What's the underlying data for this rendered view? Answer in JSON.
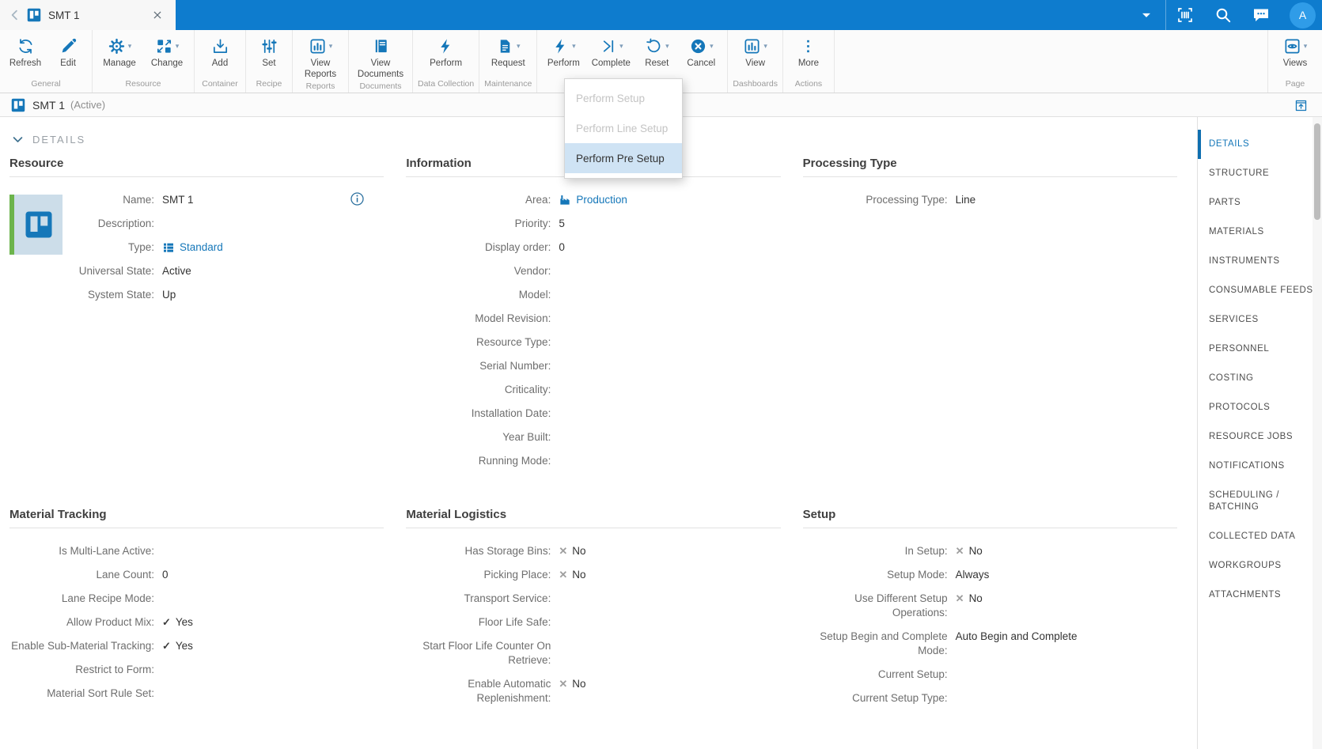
{
  "colors": {
    "topbar": "#0e7cce",
    "accent": "#1577b9",
    "menu_highlight": "#cfe3f4",
    "tile_green": "#6cb44c"
  },
  "topbar": {
    "tab": {
      "title": "SMT 1"
    },
    "avatar": {
      "initial": "A"
    },
    "icons": [
      "chevron-left-icon",
      "resource-board-icon",
      "close-icon",
      "dropdown-caret-icon",
      "barcode-scanner-icon",
      "search-icon",
      "messages-icon"
    ]
  },
  "toolbar": {
    "groups": [
      {
        "label": "General",
        "buttons": [
          {
            "label": "Refresh",
            "icon": "refresh-icon",
            "caret": false
          },
          {
            "label": "Edit",
            "icon": "edit-pencil-icon",
            "caret": false
          }
        ]
      },
      {
        "label": "Resource",
        "buttons": [
          {
            "label": "Manage",
            "icon": "manage-gear-icon",
            "caret": true
          },
          {
            "label": "Change",
            "icon": "change-swap-icon",
            "caret": true
          }
        ]
      },
      {
        "label": "Container",
        "buttons": [
          {
            "label": "Add",
            "icon": "add-tray-icon",
            "caret": false
          }
        ]
      },
      {
        "label": "Recipe",
        "buttons": [
          {
            "label": "Set",
            "icon": "sliders-icon",
            "caret": false
          }
        ]
      },
      {
        "label": "Reports",
        "buttons": [
          {
            "label": "View Reports",
            "icon": "bar-chart-icon",
            "caret": true
          }
        ]
      },
      {
        "label": "Documents",
        "buttons": [
          {
            "label": "View Documents",
            "icon": "documents-book-icon",
            "caret": false
          }
        ]
      },
      {
        "label": "Data Collection",
        "buttons": [
          {
            "label": "Perform",
            "icon": "lightning-icon",
            "caret": false
          }
        ]
      },
      {
        "label": "Maintenance",
        "buttons": [
          {
            "label": "Request",
            "icon": "document-page-icon",
            "caret": true
          }
        ]
      },
      {
        "label": "",
        "buttons": [
          {
            "label": "Perform",
            "icon": "lightning-icon",
            "caret": true
          },
          {
            "label": "Complete",
            "icon": "skip-end-icon",
            "caret": true
          },
          {
            "label": "Reset",
            "icon": "reset-arrow-icon",
            "caret": true
          },
          {
            "label": "Cancel",
            "icon": "cancel-circle-icon",
            "caret": true
          }
        ]
      },
      {
        "label": "Dashboards",
        "buttons": [
          {
            "label": "View",
            "icon": "bar-chart-icon",
            "caret": true
          }
        ]
      },
      {
        "label": "Actions",
        "buttons": [
          {
            "label": "More",
            "icon": "more-dots-icon",
            "caret": false
          }
        ]
      },
      {
        "label": "Page",
        "buttons": [
          {
            "label": "Views",
            "icon": "views-eye-icon",
            "caret": true
          }
        ]
      }
    ]
  },
  "perform_menu": {
    "items": [
      {
        "label": "Perform Setup",
        "disabled": true,
        "highlighted": false
      },
      {
        "label": "Perform Line Setup",
        "disabled": true,
        "highlighted": false
      },
      {
        "label": "Perform Pre Setup",
        "disabled": false,
        "highlighted": true
      }
    ]
  },
  "breadcrumb": {
    "title": "SMT 1",
    "state": "(Active)"
  },
  "details_section": {
    "label": "DETAILS"
  },
  "panels": {
    "resource": {
      "title": "Resource",
      "fields": [
        {
          "label": "Name:",
          "value": "SMT 1",
          "value_icon": null
        },
        {
          "label": "Description:",
          "value": "",
          "value_icon": null
        },
        {
          "label": "Type:",
          "value": "Standard",
          "value_icon": "list-icon",
          "link": true
        },
        {
          "label": "Universal State:",
          "value": "Active",
          "value_icon": null
        },
        {
          "label": "System State:",
          "value": "Up",
          "value_icon": null
        }
      ]
    },
    "information": {
      "title": "Information",
      "fields": [
        {
          "label": "Area:",
          "value": "Production",
          "value_icon": "factory-icon",
          "link": true
        },
        {
          "label": "Priority:",
          "value": "5",
          "value_icon": null
        },
        {
          "label": "Display order:",
          "value": "0",
          "value_icon": null
        },
        {
          "label": "Vendor:",
          "value": "",
          "value_icon": null
        },
        {
          "label": "Model:",
          "value": "",
          "value_icon": null
        },
        {
          "label": "Model Revision:",
          "value": "",
          "value_icon": null
        },
        {
          "label": "Resource Type:",
          "value": "",
          "value_icon": null
        },
        {
          "label": "Serial Number:",
          "value": "",
          "value_icon": null
        },
        {
          "label": "Criticality:",
          "value": "",
          "value_icon": null
        },
        {
          "label": "Installation Date:",
          "value": "",
          "value_icon": null
        },
        {
          "label": "Year Built:",
          "value": "",
          "value_icon": null
        },
        {
          "label": "Running Mode:",
          "value": "",
          "value_icon": null
        }
      ]
    },
    "processing": {
      "title": "Processing Type",
      "fields": [
        {
          "label": "Processing Type:",
          "value": "Line",
          "value_icon": null
        }
      ]
    },
    "material_tracking": {
      "title": "Material Tracking",
      "fields": [
        {
          "label": "Is Multi-Lane Active:",
          "value": "",
          "value_icon": null
        },
        {
          "label": "Lane Count:",
          "value": "0",
          "value_icon": null
        },
        {
          "label": "Lane Recipe Mode:",
          "value": "",
          "value_icon": null
        },
        {
          "label": "Allow Product Mix:",
          "value": "Yes",
          "value_icon": "check"
        },
        {
          "label": "Enable Sub-Material Tracking:",
          "value": "Yes",
          "value_icon": "check"
        },
        {
          "label": "Restrict to Form:",
          "value": "",
          "value_icon": null
        },
        {
          "label": "Material Sort Rule Set:",
          "value": "",
          "value_icon": null
        }
      ]
    },
    "material_logistics": {
      "title": "Material Logistics",
      "fields": [
        {
          "label": "Has Storage Bins:",
          "value": "No",
          "value_icon": "cross"
        },
        {
          "label": "Picking Place:",
          "value": "No",
          "value_icon": "cross"
        },
        {
          "label": "Transport Service:",
          "value": "",
          "value_icon": null
        },
        {
          "label": "Floor Life Safe:",
          "value": "",
          "value_icon": null
        },
        {
          "label": "Start Floor Life Counter On Retrieve:",
          "value": "",
          "value_icon": null
        },
        {
          "label": "Enable Automatic Replenishment:",
          "value": "No",
          "value_icon": "cross"
        }
      ]
    },
    "setup": {
      "title": "Setup",
      "fields": [
        {
          "label": "In Setup:",
          "value": "No",
          "value_icon": "cross"
        },
        {
          "label": "Setup Mode:",
          "value": "Always",
          "value_icon": null
        },
        {
          "label": "Use Different Setup Operations:",
          "value": "No",
          "value_icon": "cross"
        },
        {
          "label": "Setup Begin and Complete Mode:",
          "value": "Auto Begin and Complete",
          "value_icon": null
        },
        {
          "label": "Current Setup:",
          "value": "",
          "value_icon": null
        },
        {
          "label": "Current Setup Type:",
          "value": "",
          "value_icon": null
        }
      ]
    }
  },
  "sidebar": {
    "active_index": 0,
    "items": [
      "DETAILS",
      "STRUCTURE",
      "PARTS",
      "MATERIALS",
      "INSTRUMENTS",
      "CONSUMABLE FEEDS",
      "SERVICES",
      "PERSONNEL",
      "COSTING",
      "PROTOCOLS",
      "RESOURCE JOBS",
      "NOTIFICATIONS",
      "SCHEDULING / BATCHING",
      "COLLECTED DATA",
      "WORKGROUPS",
      "ATTACHMENTS"
    ]
  }
}
